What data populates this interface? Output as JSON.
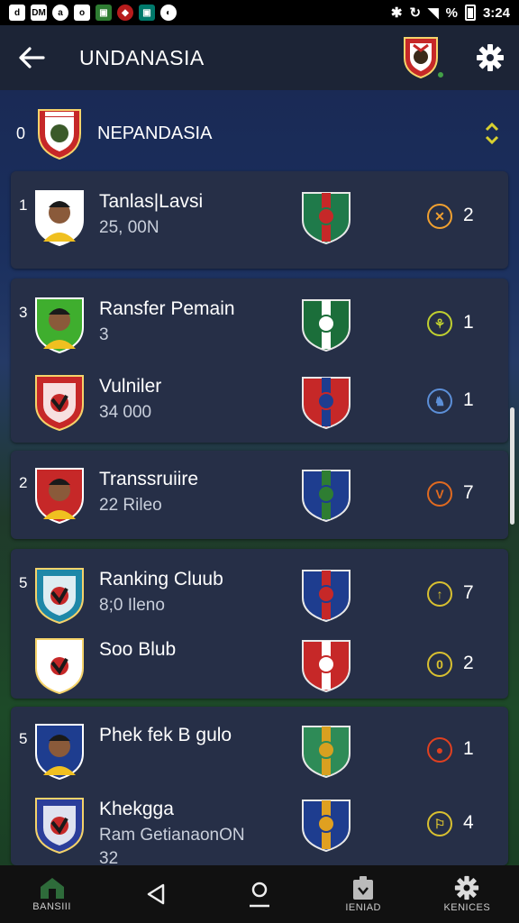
{
  "status_bar": {
    "icons": [
      "d",
      "DM",
      "a",
      "o",
      "▣",
      "◆",
      "▣",
      "◐"
    ],
    "icon_names": [
      "notification-icon",
      "message-icon",
      "app-icon",
      "app-icon-2",
      "photos-icon",
      "game-icon",
      "app-icon-3",
      "clock-icon"
    ],
    "percent": "%",
    "time": "3:24"
  },
  "app_bar": {
    "title": "UNDANASIA",
    "back_icon": "arrow-left-icon",
    "settings_icon": "gear-icon"
  },
  "section": {
    "rank": "0",
    "title": "NEPANDASIA",
    "sort_icon": "sort-chevrons-icon"
  },
  "cards": [
    {
      "rows": [
        {
          "rank": "1",
          "name": "Tanlas|Lavsi",
          "sub": "25, 00N",
          "count": "2",
          "badge_glyph": "✕",
          "badge_color": "#f0a030",
          "avatar": "player",
          "avatar_bg": "#ffffff",
          "club_colors": [
            "#1f7a4a",
            "#c62828"
          ]
        }
      ]
    },
    {
      "rows": [
        {
          "rank": "3",
          "name": "Ransfer Pemain",
          "sub": "3",
          "count": "1",
          "badge_glyph": "⚘",
          "badge_color": "#c0d030",
          "avatar": "player",
          "avatar_bg": "#3fae2e",
          "club_colors": [
            "#1b6e3a",
            "#ffffff"
          ]
        },
        {
          "rank": "",
          "name": "Vulniler",
          "sub": "34 000",
          "count": "1",
          "badge_glyph": "♞",
          "badge_color": "#5c8fd8",
          "avatar": "crest",
          "avatar_bg": "#c62828",
          "club_colors": [
            "#c62828",
            "#1e3d8f"
          ]
        }
      ]
    },
    {
      "rows": [
        {
          "rank": "2",
          "name": "Transsruiire",
          "sub": "22 Rileo",
          "count": "7",
          "badge_glyph": "V",
          "badge_color": "#e06a20",
          "avatar": "player",
          "avatar_bg": "#c62828",
          "club_colors": [
            "#1e3d8f",
            "#2e7d32"
          ]
        }
      ]
    },
    {
      "rows": [
        {
          "rank": "5",
          "name": "Ranking Cluub",
          "sub": "8;0 Ileno",
          "count": "7",
          "badge_glyph": "↑",
          "badge_color": "#d8c030",
          "avatar": "crest",
          "avatar_bg": "#1e88a8",
          "club_colors": [
            "#1e3d8f",
            "#c62828"
          ]
        },
        {
          "rank": "",
          "name": "Soo Blub",
          "sub": "",
          "count": "2",
          "badge_glyph": "0",
          "badge_color": "#d8c030",
          "avatar": "crest",
          "avatar_bg": "#ffffff",
          "club_colors": [
            "#c62828",
            "#ffffff"
          ]
        }
      ]
    },
    {
      "rows": [
        {
          "rank": "5",
          "name": "Phek fek B gulo",
          "sub": "",
          "count": "1",
          "badge_glyph": "●",
          "badge_color": "#e04020",
          "avatar": "player",
          "avatar_bg": "#1e3d8f",
          "club_colors": [
            "#2e8b57",
            "#d8a020"
          ]
        },
        {
          "rank": "",
          "name": "Khekgga",
          "sub": "Ram GetianaonON",
          "sub2": "32",
          "count": "4",
          "badge_glyph": "⚐",
          "badge_color": "#d8c030",
          "avatar": "crest",
          "avatar_bg": "#2c3e9a",
          "club_colors": [
            "#1e3d8f",
            "#e0a020"
          ]
        }
      ]
    }
  ],
  "nav_bar": {
    "items": [
      {
        "label": "BANSIII",
        "icon": "home-icon"
      },
      {
        "label": "",
        "icon": "back-triangle-icon"
      },
      {
        "label": "",
        "icon": "profile-icon"
      },
      {
        "label": "IENIAD",
        "icon": "tasks-icon"
      },
      {
        "label": "KENICES",
        "icon": "gear-icon"
      }
    ]
  }
}
